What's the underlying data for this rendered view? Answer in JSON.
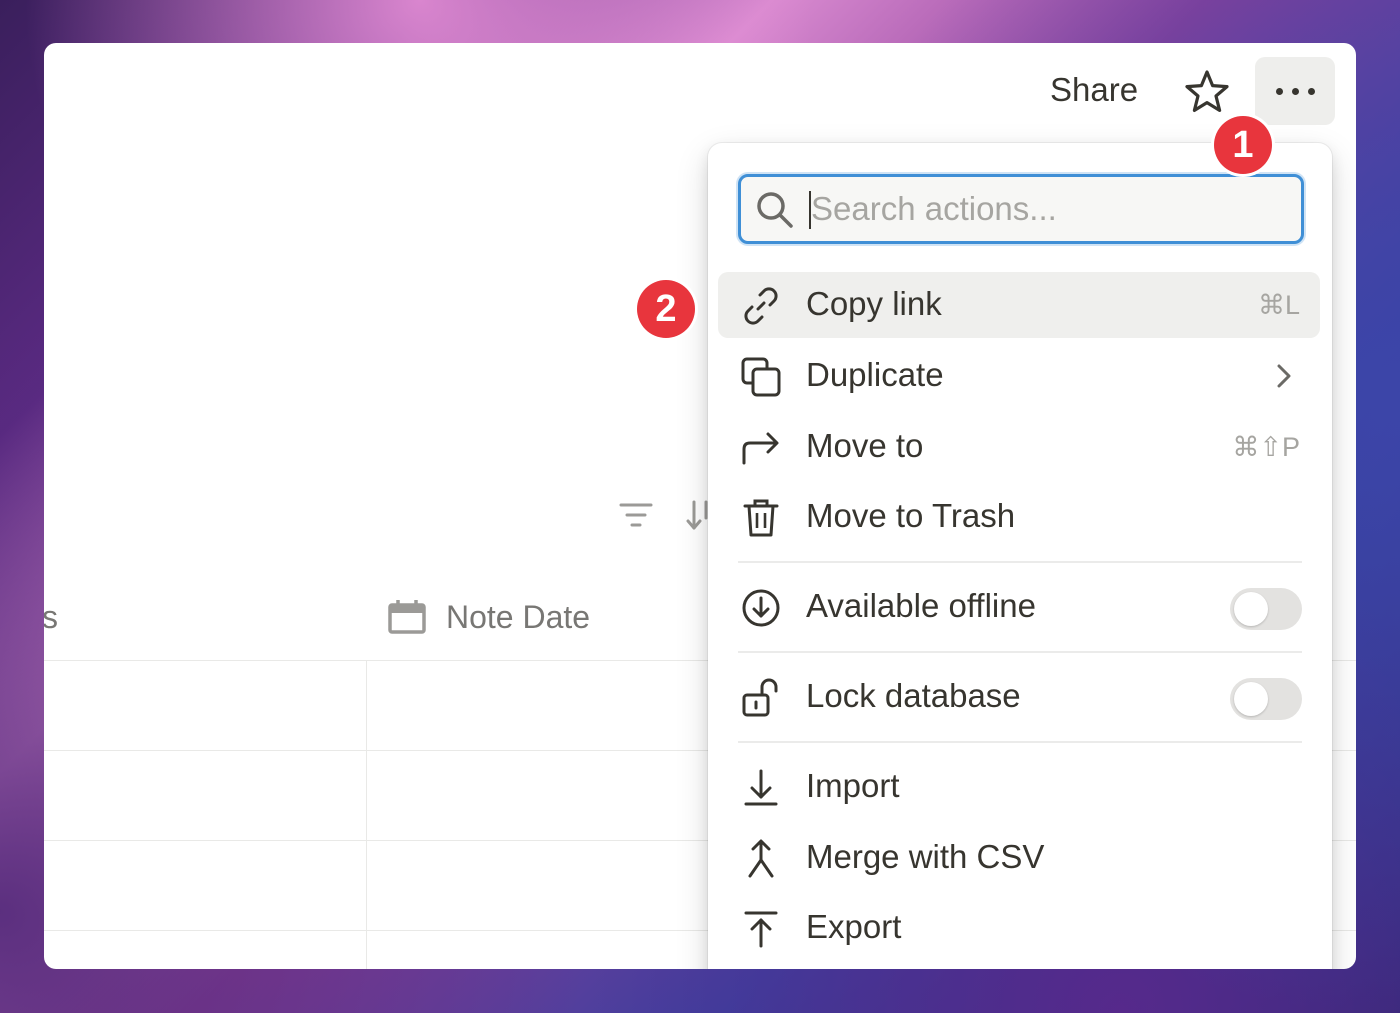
{
  "topbar": {
    "share_label": "Share",
    "favorite_icon": "star-icon",
    "more_icon": "more-horizontal-icon"
  },
  "annotations": {
    "step1": "1",
    "step2": "2",
    "color": "#e8353d"
  },
  "table": {
    "truncated_header": "s",
    "date_column": "Note Date",
    "date_icon": "calendar-icon"
  },
  "menu": {
    "search_placeholder": "Search actions...",
    "search_value": "",
    "focus_color": "#3f8fd6",
    "items": [
      {
        "label": "Copy link",
        "icon": "link-icon",
        "shortcut": "⌘L",
        "highlighted": true
      },
      {
        "label": "Duplicate",
        "icon": "duplicate-icon",
        "submenu": true
      },
      {
        "label": "Move to",
        "icon": "move-arrow-icon",
        "shortcut": "⌘⇧P"
      },
      {
        "label": "Move to Trash",
        "icon": "trash-icon"
      },
      {
        "label": "Available offline",
        "icon": "download-circle-icon",
        "toggle": false
      },
      {
        "label": "Lock database",
        "icon": "unlock-icon",
        "toggle": false
      },
      {
        "label": "Import",
        "icon": "import-icon"
      },
      {
        "label": "Merge with CSV",
        "icon": "merge-icon"
      },
      {
        "label": "Export",
        "icon": "export-icon"
      }
    ]
  }
}
